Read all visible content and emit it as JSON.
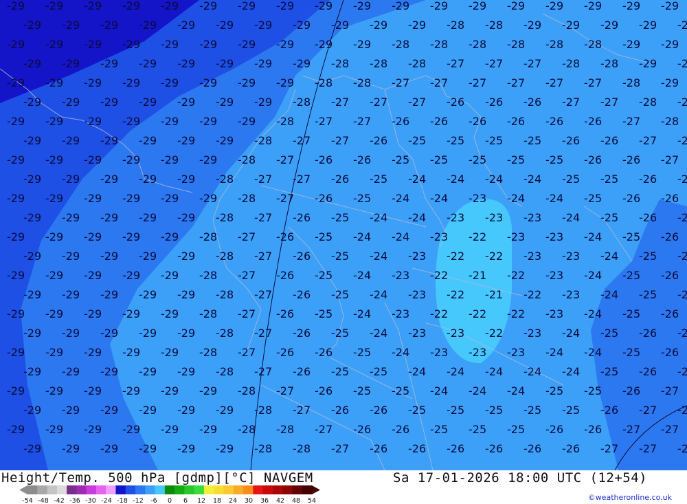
{
  "map": {
    "title": "Height/Temp. 500 hPa [gdmp][°C] NAVGEM",
    "datetime": "Sa 17-01-2026 18:00 UTC (12+54)",
    "credit": "©weatheronline.co.uk",
    "isoline_values": [
      -29,
      -28,
      -27,
      -26,
      -25,
      -24,
      -23,
      -22,
      -21
    ],
    "legend": {
      "labels": [
        "-54",
        "-48",
        "-42",
        "-36",
        "-30",
        "-24",
        "-18",
        "-12",
        "-6",
        "0",
        "6",
        "12",
        "18",
        "24",
        "30",
        "36",
        "42",
        "48",
        "54"
      ],
      "colors": [
        "#8c8c8c",
        "#a8a8a8",
        "#c4c4c4",
        "#dcdcdc",
        "#7a2d8e",
        "#a02ab4",
        "#c83cdc",
        "#e664f0",
        "#f0a0f8",
        "#1414c8",
        "#1e50e6",
        "#2c78f0",
        "#3ca0f8",
        "#46c8fc",
        "#0a8c0a",
        "#14aa14",
        "#28c828",
        "#3cdc3c",
        "#f0f03c",
        "#fadc32",
        "#fac832",
        "#faaa28",
        "#fa8c1e",
        "#e61414",
        "#c80a0a",
        "#aa0808",
        "#8c0606",
        "#640404",
        "#460202"
      ]
    },
    "zone_colors": {
      "t_lt_-30": "#1414c8",
      "t_-30_-27": "#1e50e6",
      "t_-27_-24": "#2c78f0",
      "t_-24_-21": "#3ca0f8",
      "t_gt_-21": "#46c8fc"
    }
  }
}
